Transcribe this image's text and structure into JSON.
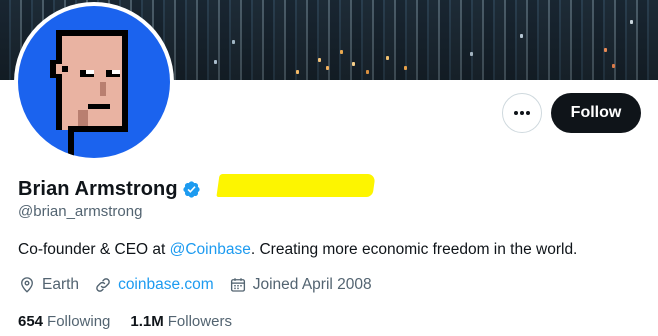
{
  "profile": {
    "display_name": "Brian Armstrong",
    "handle": "@brian_armstrong",
    "bio_prefix": "Co-founder & CEO at ",
    "bio_mention": "@Coinbase",
    "bio_suffix": ". Creating more economic freedom in the world.",
    "location": "Earth",
    "website": "coinbase.com",
    "joined": "Joined April 2008"
  },
  "actions": {
    "follow_label": "Follow"
  },
  "stats": {
    "following_count": "654",
    "following_label": "Following",
    "followers_count": "1.1M",
    "followers_label": "Followers"
  },
  "colors": {
    "accent": "#1d9bf0",
    "text_primary": "#0f1419",
    "text_secondary": "#536471",
    "avatar_bg": "#1b63ee",
    "highlight": "#fdf500"
  },
  "icons": {
    "more": "more-horizontal-icon",
    "verified": "verified-badge-icon",
    "location": "location-pin-icon",
    "link": "link-icon",
    "calendar": "calendar-icon"
  }
}
